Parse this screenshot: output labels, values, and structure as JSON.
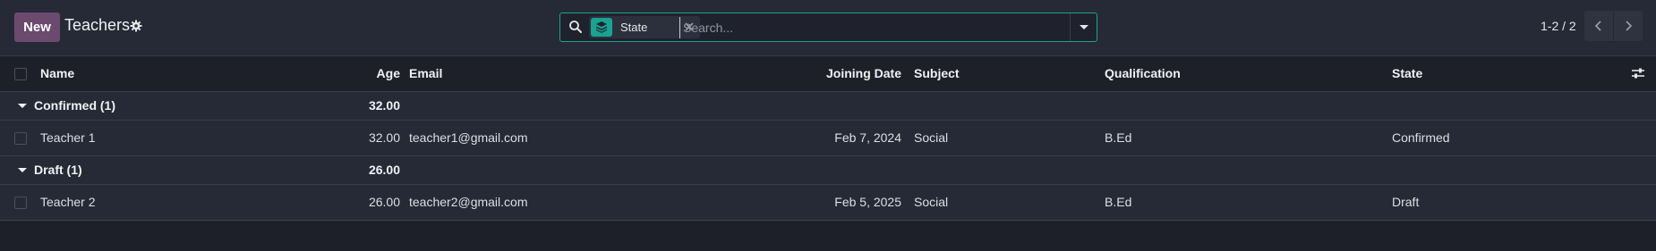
{
  "control_panel": {
    "new_label": "New",
    "title": "Teachers",
    "gear_icon": "gear-icon",
    "search": {
      "facet_icon": "layers-icon",
      "facet_label": "State",
      "remove_icon": "close-icon",
      "placeholder": "Search...",
      "value": "",
      "toggle_icon": "caret-down-icon"
    },
    "pager": {
      "value": "1-2 / 2",
      "prev_icon": "chevron-left-icon",
      "next_icon": "chevron-right-icon"
    }
  },
  "table": {
    "columns": {
      "name": "Name",
      "age": "Age",
      "email": "Email",
      "joining_date": "Joining Date",
      "subject": "Subject",
      "qualification": "Qualification",
      "state": "State"
    },
    "optional_columns_icon": "sliders-icon",
    "groups": [
      {
        "label": "Confirmed (1)",
        "age_total": "32.00",
        "rows": [
          {
            "name": "Teacher 1",
            "age": "32.00",
            "email": "teacher1@gmail.com",
            "joining_date": "Feb 7, 2024",
            "subject": "Social",
            "qualification": "B.Ed",
            "state": "Confirmed"
          }
        ]
      },
      {
        "label": "Draft (1)",
        "age_total": "26.00",
        "rows": [
          {
            "name": "Teacher 2",
            "age": "26.00",
            "email": "teacher2@gmail.com",
            "joining_date": "Feb 5, 2025",
            "subject": "Social",
            "qualification": "B.Ed",
            "state": "Draft"
          }
        ]
      }
    ]
  },
  "colors": {
    "accent": "#1aa392",
    "new_button": "#6b4a6e",
    "background": "#262a36",
    "header_background": "#1d2029"
  }
}
